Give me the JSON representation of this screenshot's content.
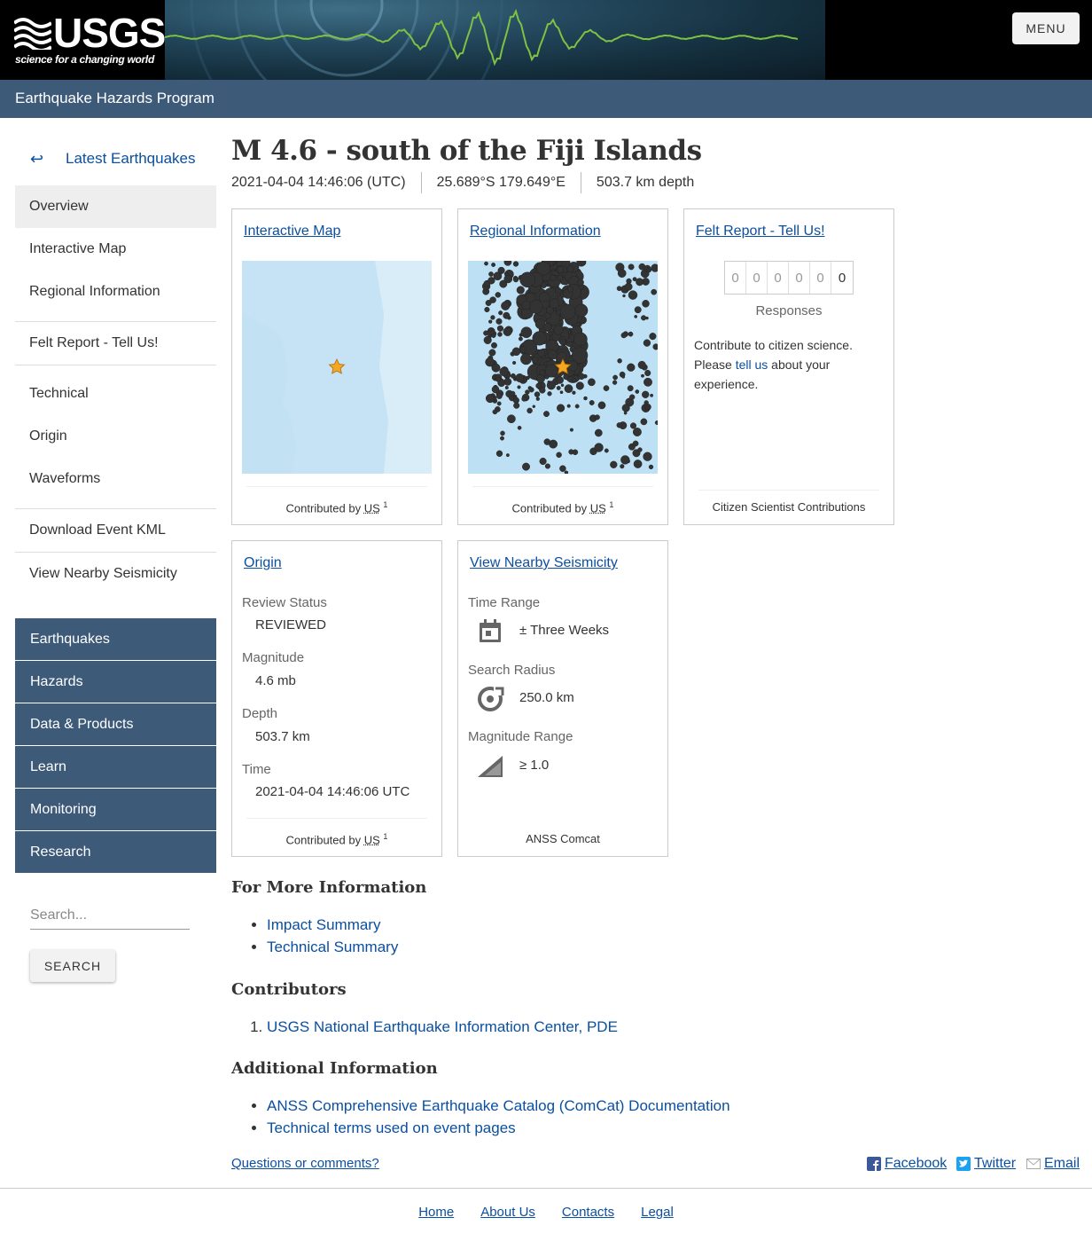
{
  "header": {
    "logo_text": "USGS",
    "logo_tagline": "science for a changing world",
    "menu_label": "MENU",
    "program_title": "Earthquake Hazards Program"
  },
  "sidebar": {
    "back_link": "Latest Earthquakes",
    "items": [
      {
        "label": "Overview"
      },
      {
        "label": "Interactive Map"
      },
      {
        "label": "Regional Information"
      },
      {
        "label": "Felt Report - Tell Us!"
      },
      {
        "label": "Technical"
      },
      {
        "label": "Origin"
      },
      {
        "label": "Waveforms"
      },
      {
        "label": "Download Event KML"
      },
      {
        "label": "View Nearby Seismicity"
      }
    ],
    "site_nav": [
      "Earthquakes",
      "Hazards",
      "Data & Products",
      "Learn",
      "Monitoring",
      "Research"
    ],
    "search_placeholder": "Search...",
    "search_button": "SEARCH"
  },
  "event": {
    "title": "M 4.6 - south of the Fiji Islands",
    "time": "2021-04-04 14:46:06 (UTC)",
    "location": "25.689°S 179.649°E",
    "depth": "503.7 km depth"
  },
  "cards": {
    "interactive_map": {
      "title": "Interactive Map",
      "contributed_by": "Contributed by",
      "network": "US",
      "ref": "1"
    },
    "regional": {
      "title": "Regional Information",
      "contributed_by": "Contributed by",
      "network": "US",
      "ref": "1"
    },
    "felt": {
      "title": "Felt Report - Tell Us!",
      "digits": [
        "0",
        "0",
        "0",
        "0",
        "0",
        "0"
      ],
      "responses_label": "Responses",
      "text_before": "Contribute to citizen science. Please ",
      "link_text": "tell us",
      "text_after": " about your experience.",
      "footer": "Citizen Scientist Contributions"
    },
    "origin": {
      "title": "Origin",
      "review_status_label": "Review Status",
      "review_status": "REVIEWED",
      "magnitude_label": "Magnitude",
      "magnitude": "4.6 mb",
      "depth_label": "Depth",
      "depth": "503.7 km",
      "time_label": "Time",
      "time": "2021-04-04 14:46:06 UTC",
      "contributed_by": "Contributed by",
      "network": "US",
      "ref": "1"
    },
    "nearby": {
      "title": "View Nearby Seismicity",
      "time_range_label": "Time Range",
      "time_range": "± Three Weeks",
      "search_radius_label": "Search Radius",
      "search_radius": "250.0 km",
      "magnitude_range_label": "Magnitude Range",
      "magnitude_range": "≥ 1.0",
      "footer": "ANSS Comcat"
    }
  },
  "more_info": {
    "heading": "For More Information",
    "links": [
      "Impact Summary",
      "Technical Summary"
    ]
  },
  "contributors": {
    "heading": "Contributors",
    "items": [
      "USGS National Earthquake Information Center, PDE"
    ]
  },
  "additional": {
    "heading": "Additional Information",
    "links": [
      "ANSS Comprehensive Earthquake Catalog (ComCat) Documentation",
      "Technical terms used on event pages"
    ]
  },
  "footer": {
    "questions": "Questions or comments?",
    "share": [
      "Facebook",
      "Twitter",
      "Email"
    ],
    "nav": [
      "Home",
      "About Us",
      "Contacts",
      "Legal"
    ]
  },
  "colors": {
    "nav_blue": "#3d5b79",
    "link_blue": "#0b4fa0",
    "seismo_green": "#7ec242"
  }
}
